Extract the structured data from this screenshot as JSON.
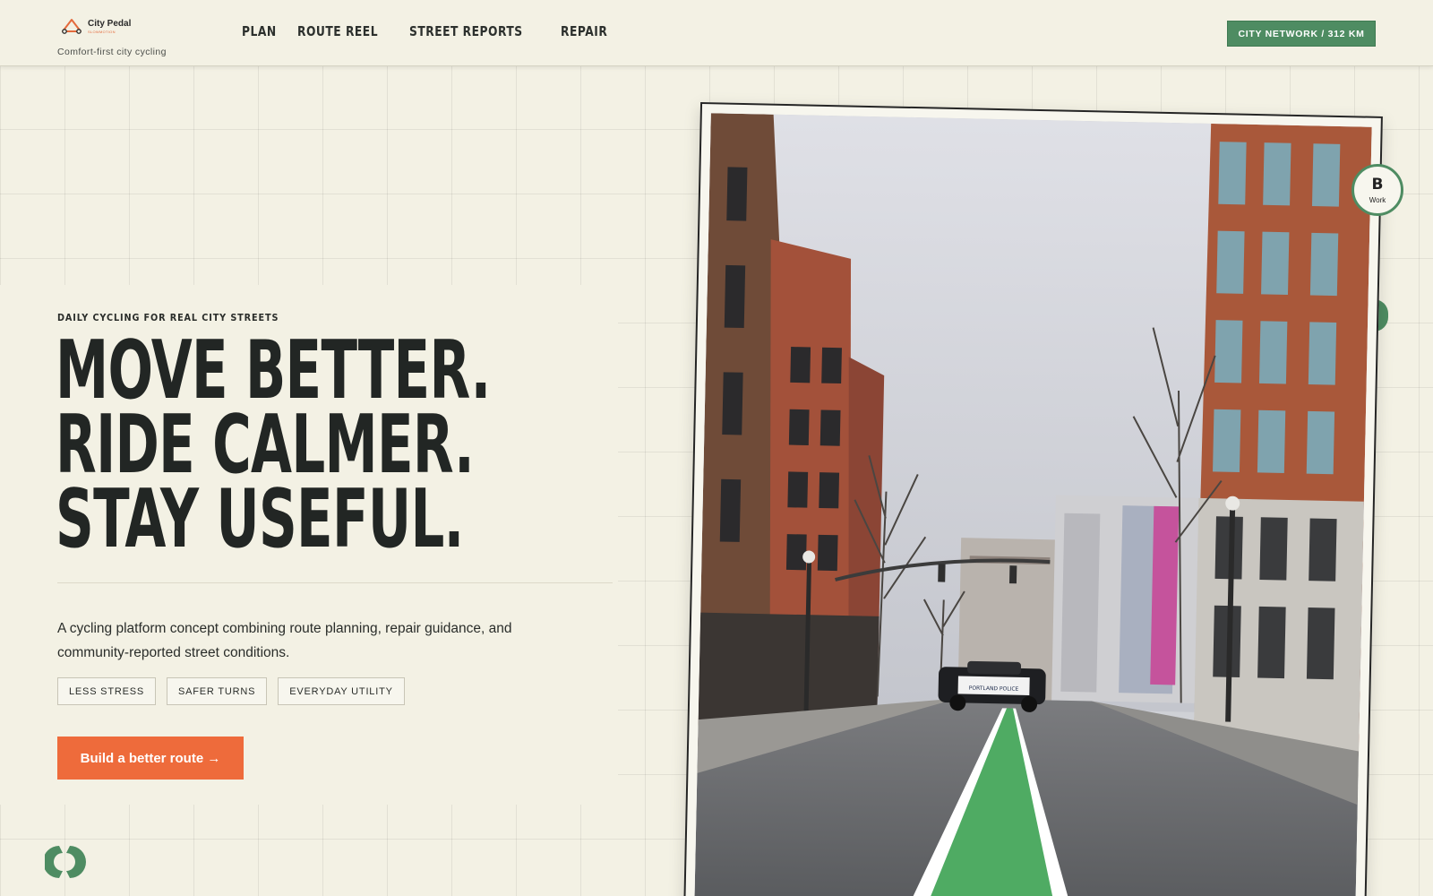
{
  "brand": {
    "name": "City Pedal",
    "sub": "SLOWMOTION",
    "tagline": "Comfort-first city cycling",
    "logo_icon": "bike-triangle-icon"
  },
  "nav": {
    "items": [
      {
        "label": "PLAN"
      },
      {
        "label": "ROUTE REEL"
      },
      {
        "label": "STREET REPORTS"
      },
      {
        "label": "REPAIR"
      }
    ]
  },
  "network_badge": "CITY NETWORK / 312 KM",
  "hero": {
    "eyebrow": "DAILY CYCLING FOR REAL CITY STREETS",
    "headline": [
      "MOVE BETTER.",
      "RIDE CALMER.",
      "STAY USEFUL."
    ],
    "description": "A cycling platform concept combining route planning, repair guidance, and community-reported street conditions.",
    "pills": [
      "LESS STRESS",
      "SAFER TURNS",
      "EVERYDAY UTILITY"
    ],
    "cta": "Build a better route →"
  },
  "stamp": {
    "letter": "B",
    "label": "Work"
  },
  "photo": {
    "subject": "city-street-green-bike-lane",
    "police_label": "PORTLAND POLICE"
  },
  "colors": {
    "background": "#f3f1e4",
    "accent_orange": "#ee6b3b",
    "accent_green": "#4e8c62",
    "text": "#222624"
  }
}
